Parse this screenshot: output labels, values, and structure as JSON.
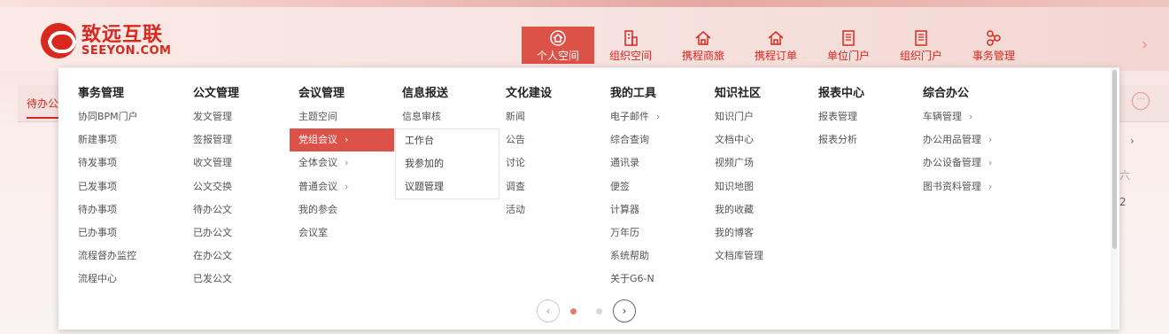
{
  "brand": {
    "name_cn": "致远互联",
    "name_en": "SEEYON.COM",
    "color": "#d9281e"
  },
  "nav": {
    "items": [
      {
        "label": "个人空间",
        "icon": "home-icon",
        "active": true
      },
      {
        "label": "组织空间",
        "icon": "building-icon"
      },
      {
        "label": "携程商旅",
        "icon": "home-icon"
      },
      {
        "label": "携程订单",
        "icon": "home-icon"
      },
      {
        "label": "单位门户",
        "icon": "document-icon"
      },
      {
        "label": "组织门户",
        "icon": "document-icon"
      },
      {
        "label": "事务管理",
        "icon": "workflow-icon"
      }
    ],
    "more_arrow": "›",
    "accent": "#dc5148"
  },
  "subbar": {
    "tab_label": "待办公",
    "more_icon": "···"
  },
  "right_fragments": {
    "chevron": "›",
    "line1": "六",
    "line2": "2"
  },
  "menu": {
    "columns": [
      {
        "title": "事务管理",
        "items": [
          {
            "label": "协同BPM门户"
          },
          {
            "label": "新建事项"
          },
          {
            "label": "待发事项"
          },
          {
            "label": "已发事项"
          },
          {
            "label": "待办事项"
          },
          {
            "label": "已办事项"
          },
          {
            "label": "流程督办监控"
          },
          {
            "label": "流程中心"
          }
        ]
      },
      {
        "title": "公文管理",
        "items": [
          {
            "label": "发文管理"
          },
          {
            "label": "签报管理"
          },
          {
            "label": "收文管理"
          },
          {
            "label": "公文交换"
          },
          {
            "label": "待办公文"
          },
          {
            "label": "已办公文"
          },
          {
            "label": "在办公文"
          },
          {
            "label": "已发公文"
          }
        ]
      },
      {
        "title": "会议管理",
        "items": [
          {
            "label": "主题空间"
          },
          {
            "label": "党组会议",
            "chevron": "›",
            "active": true
          },
          {
            "label": "全体会议",
            "chevron": "›"
          },
          {
            "label": "普通会议",
            "chevron": "›"
          },
          {
            "label": "我的参会"
          },
          {
            "label": "会议室"
          }
        ]
      },
      {
        "title": "信息报送",
        "items": [
          {
            "label": "信息审核"
          }
        ]
      },
      {
        "title": "文化建设",
        "items": [
          {
            "label": "新闻"
          },
          {
            "label": "公告"
          },
          {
            "label": "讨论"
          },
          {
            "label": "调查"
          },
          {
            "label": "活动"
          }
        ]
      },
      {
        "title": "我的工具",
        "items": [
          {
            "label": "电子邮件",
            "chevron": "›"
          },
          {
            "label": "综合查询"
          },
          {
            "label": "通讯录"
          },
          {
            "label": "便签"
          },
          {
            "label": "计算器"
          },
          {
            "label": "万年历"
          },
          {
            "label": "系统帮助"
          },
          {
            "label": "关于G6-N"
          }
        ]
      },
      {
        "title": "知识社区",
        "items": [
          {
            "label": "知识门户"
          },
          {
            "label": "文档中心"
          },
          {
            "label": "视频广场"
          },
          {
            "label": "知识地图"
          },
          {
            "label": "我的收藏"
          },
          {
            "label": "我的博客"
          },
          {
            "label": "文档库管理"
          }
        ]
      },
      {
        "title": "报表中心",
        "items": [
          {
            "label": "报表管理"
          },
          {
            "label": "报表分析"
          }
        ]
      },
      {
        "title": "综合办公",
        "items": [
          {
            "label": "车辆管理",
            "chevron": "›"
          },
          {
            "label": "办公用品管理",
            "chevron": "›"
          },
          {
            "label": "办公设备管理",
            "chevron": "›"
          },
          {
            "label": "图书资料管理",
            "chevron": "›"
          }
        ]
      }
    ],
    "submenu": [
      {
        "label": "工作台"
      },
      {
        "label": "我参加的"
      },
      {
        "label": "议题管理"
      }
    ]
  },
  "pager": {
    "prev": "‹",
    "next": "›",
    "active_color": "#e07a72",
    "inactive_color": "#d9d9d9"
  }
}
